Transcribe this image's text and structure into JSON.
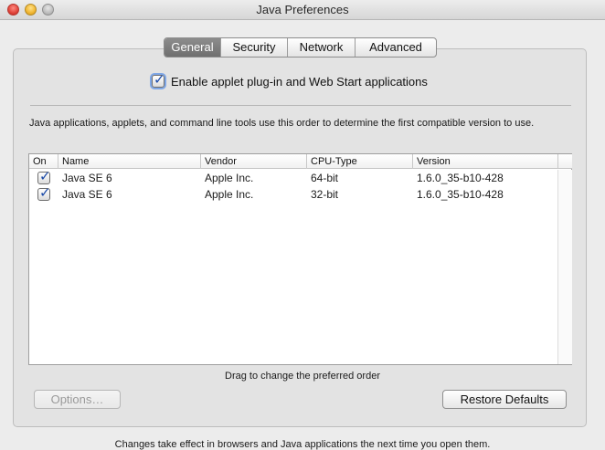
{
  "window": {
    "title": "Java Preferences"
  },
  "tabs": [
    {
      "label": "General",
      "active": true
    },
    {
      "label": "Security",
      "active": false
    },
    {
      "label": "Network",
      "active": false
    },
    {
      "label": "Advanced",
      "active": false
    }
  ],
  "general": {
    "applet_checkbox": {
      "label": "Enable applet plug-in and Web Start applications",
      "checked": true
    },
    "description": "Java applications, applets, and command line tools use this order to determine the first compatible version to use.",
    "table": {
      "headers": {
        "on": "On",
        "name": "Name",
        "vendor": "Vendor",
        "cpu": "CPU-Type",
        "version": "Version"
      },
      "rows": [
        {
          "on": true,
          "name": "Java SE 6",
          "vendor": "Apple Inc.",
          "cpu": "64-bit",
          "version": "1.6.0_35-b10-428"
        },
        {
          "on": true,
          "name": "Java SE 6",
          "vendor": "Apple Inc.",
          "cpu": "32-bit",
          "version": "1.6.0_35-b10-428"
        }
      ]
    },
    "drag_hint": "Drag to change the preferred order",
    "options_button": "Options…",
    "restore_button": "Restore Defaults"
  },
  "footer": "Changes take effect in browsers and Java applications the next time you open them.",
  "colors": {
    "active_tab": "#7d7d7d",
    "check_mark": "#1b4aa8",
    "focus_ring": "#7fa7e6"
  }
}
